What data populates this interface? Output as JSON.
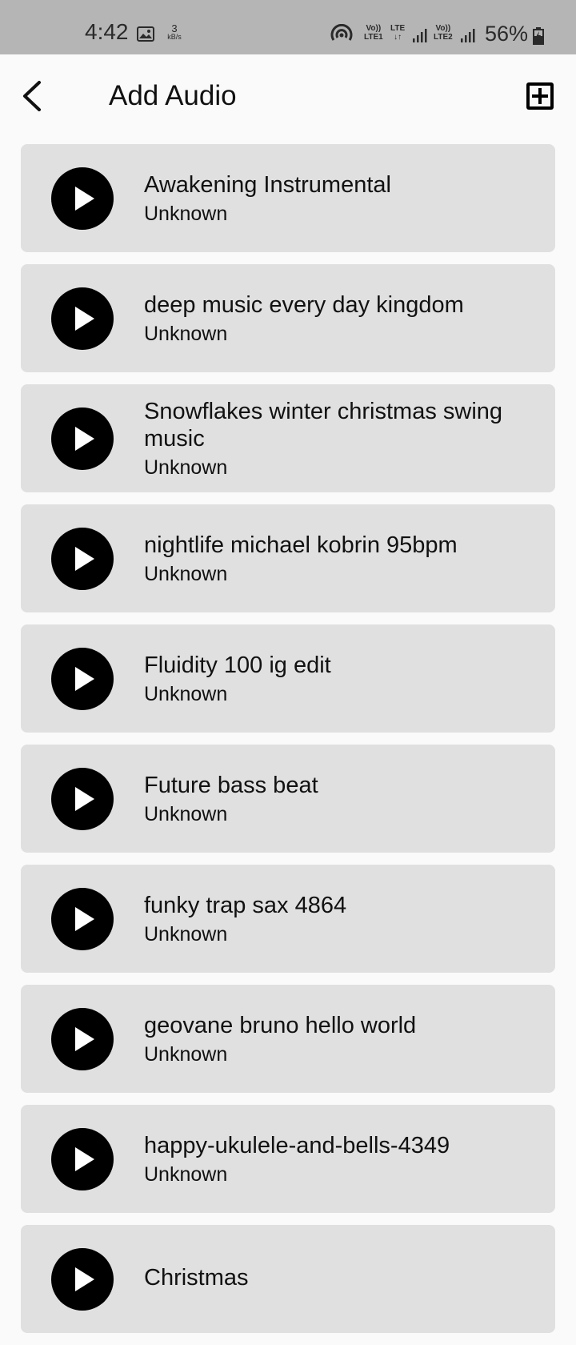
{
  "status_bar": {
    "time": "4:42",
    "speed_value": "3",
    "speed_unit": "kB/s",
    "net1_top": "Vo))",
    "net1_bottom": "LTE1",
    "lte_top": "LTE",
    "lte_bottom": "↓↑",
    "net2_top": "Vo))",
    "net2_bottom": "LTE2",
    "battery": "56%"
  },
  "app_bar": {
    "title": "Add Audio",
    "back_icon": "chevron-left-icon",
    "add_icon": "add-box-icon"
  },
  "audio_items": [
    {
      "title": "Awakening Instrumental",
      "artist": "Unknown"
    },
    {
      "title": "deep music every day kingdom",
      "artist": "Unknown"
    },
    {
      "title": "Snowflakes winter christmas swing music",
      "artist": "Unknown"
    },
    {
      "title": "nightlife michael kobrin 95bpm",
      "artist": "Unknown"
    },
    {
      "title": "Fluidity 100 ig edit",
      "artist": "Unknown"
    },
    {
      "title": "Future bass beat",
      "artist": "Unknown"
    },
    {
      "title": "funky trap sax 4864",
      "artist": "Unknown"
    },
    {
      "title": "geovane bruno hello world",
      "artist": "Unknown"
    },
    {
      "title": "happy-ukulele-and-bells-4349",
      "artist": "Unknown"
    },
    {
      "title": "Christmas",
      "artist": ""
    }
  ],
  "colors": {
    "status_bar_bg": "#b5b5b5",
    "page_bg": "#fafafa",
    "card_bg": "#e0e0e0",
    "play_bg": "#000000"
  }
}
